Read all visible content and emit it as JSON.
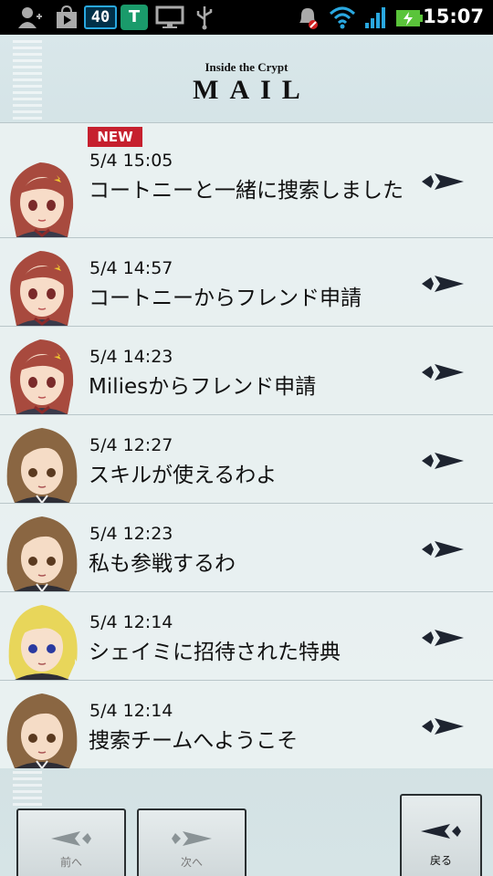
{
  "status_bar": {
    "battery_badge": "40",
    "shield_letter": "T",
    "time": "15:07"
  },
  "header": {
    "subtitle": "Inside the Crypt",
    "title": "MAIL"
  },
  "mails": [
    {
      "new_label": "NEW",
      "time": "5/4 15:05",
      "subject": "コートニーと一緒に捜索しました",
      "avatar": "courtney-avatar"
    },
    {
      "time": "5/4 14:57",
      "subject": "コートニーからフレンド申請",
      "avatar": "courtney-avatar"
    },
    {
      "time": "5/4 14:23",
      "subject": "Miliesからフレンド申請",
      "avatar": "courtney-avatar"
    },
    {
      "time": "5/4 12:27",
      "subject": "スキルが使えるわよ",
      "avatar": "brown-hair-avatar"
    },
    {
      "time": "5/4 12:23",
      "subject": "私も参戦するわ",
      "avatar": "brown-hair-avatar"
    },
    {
      "time": "5/4 12:14",
      "subject": "シェイミに招待された特典",
      "avatar": "blonde-avatar"
    },
    {
      "time": "5/4 12:14",
      "subject": "捜索チームへようこそ",
      "avatar": "brown-hair-avatar"
    }
  ],
  "nav": {
    "prev_label": "前へ",
    "next_label": "次へ",
    "back_label": "戻る"
  },
  "colors": {
    "new_badge": "#c6202e",
    "background": "#cfdde0",
    "redhair": "#a84a3e",
    "brownhair": "#8a6642",
    "blondehair": "#e8d65a"
  }
}
